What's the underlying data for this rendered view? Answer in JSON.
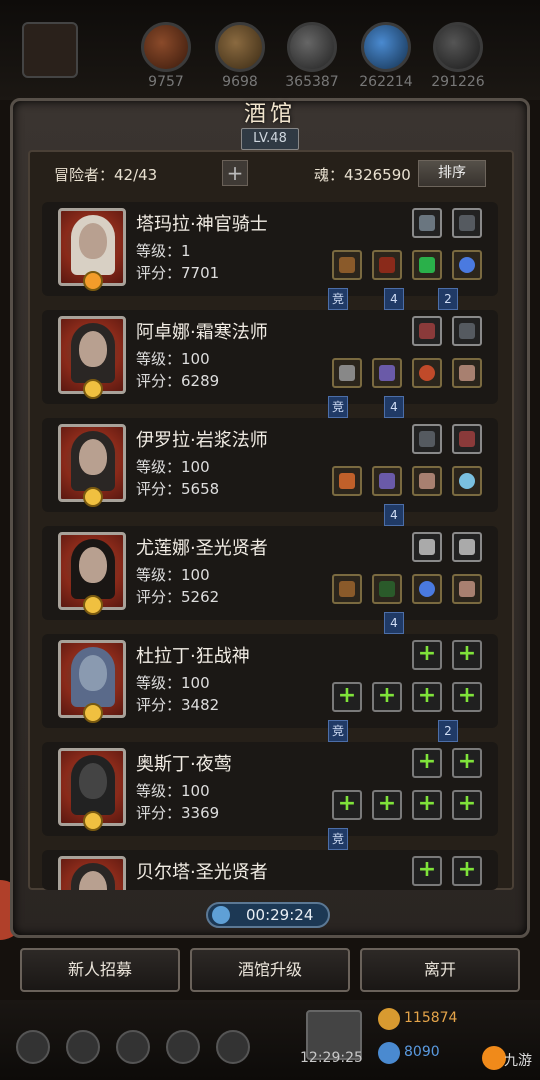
{
  "resources": [
    {
      "icon": "meat-icon",
      "value": "9757"
    },
    {
      "icon": "wood-icon",
      "value": "9698"
    },
    {
      "icon": "iron-icon",
      "value": "365387"
    },
    {
      "icon": "crystal-icon",
      "value": "262214"
    },
    {
      "icon": "ore-icon",
      "value": "291226"
    }
  ],
  "tavern": {
    "title": "酒馆",
    "level": "LV.48",
    "adventurers_label": "冒险者：42/43",
    "add_symbol": "+",
    "soul_label": "魂：4326590",
    "sort_label": "排序"
  },
  "heroes": [
    {
      "name": "塔玛拉·神官骑士",
      "level": "等级：1",
      "score": "评分：7701",
      "tags": [
        {
          "text": "竞",
          "slot": 0
        },
        {
          "text": "4",
          "slot": 1
        },
        {
          "text": "2",
          "slot": 2
        }
      ]
    },
    {
      "name": "阿卓娜·霜寒法师",
      "level": "等级：100",
      "score": "评分：6289",
      "tags": [
        {
          "text": "竞",
          "slot": 0
        },
        {
          "text": "4",
          "slot": 1
        }
      ]
    },
    {
      "name": "伊罗拉·岩浆法师",
      "level": "等级：100",
      "score": "评分：5658",
      "tags": [
        {
          "text": "4",
          "slot": 1
        }
      ]
    },
    {
      "name": "尤莲娜·圣光贤者",
      "level": "等级：100",
      "score": "评分：5262",
      "tags": [
        {
          "text": "4",
          "slot": 1
        }
      ]
    },
    {
      "name": "杜拉丁·狂战神",
      "level": "等级：100",
      "score": "评分：3482",
      "tags": [
        {
          "text": "竞",
          "slot": 0
        },
        {
          "text": "2",
          "slot": 2
        }
      ]
    },
    {
      "name": "奥斯丁·夜莺",
      "level": "等级：100",
      "score": "评分：3369",
      "tags": [
        {
          "text": "竞",
          "slot": 0
        }
      ]
    },
    {
      "name": "贝尔塔·圣光贤者",
      "level": "",
      "score": "",
      "tags": []
    }
  ],
  "timer": "00:29:24",
  "buttons": {
    "recruit": "新人招募",
    "upgrade": "酒馆升级",
    "leave": "离开"
  },
  "status": {
    "clock": "12:29:25",
    "gold": "115874",
    "gems": "8090",
    "brand": "九游"
  }
}
